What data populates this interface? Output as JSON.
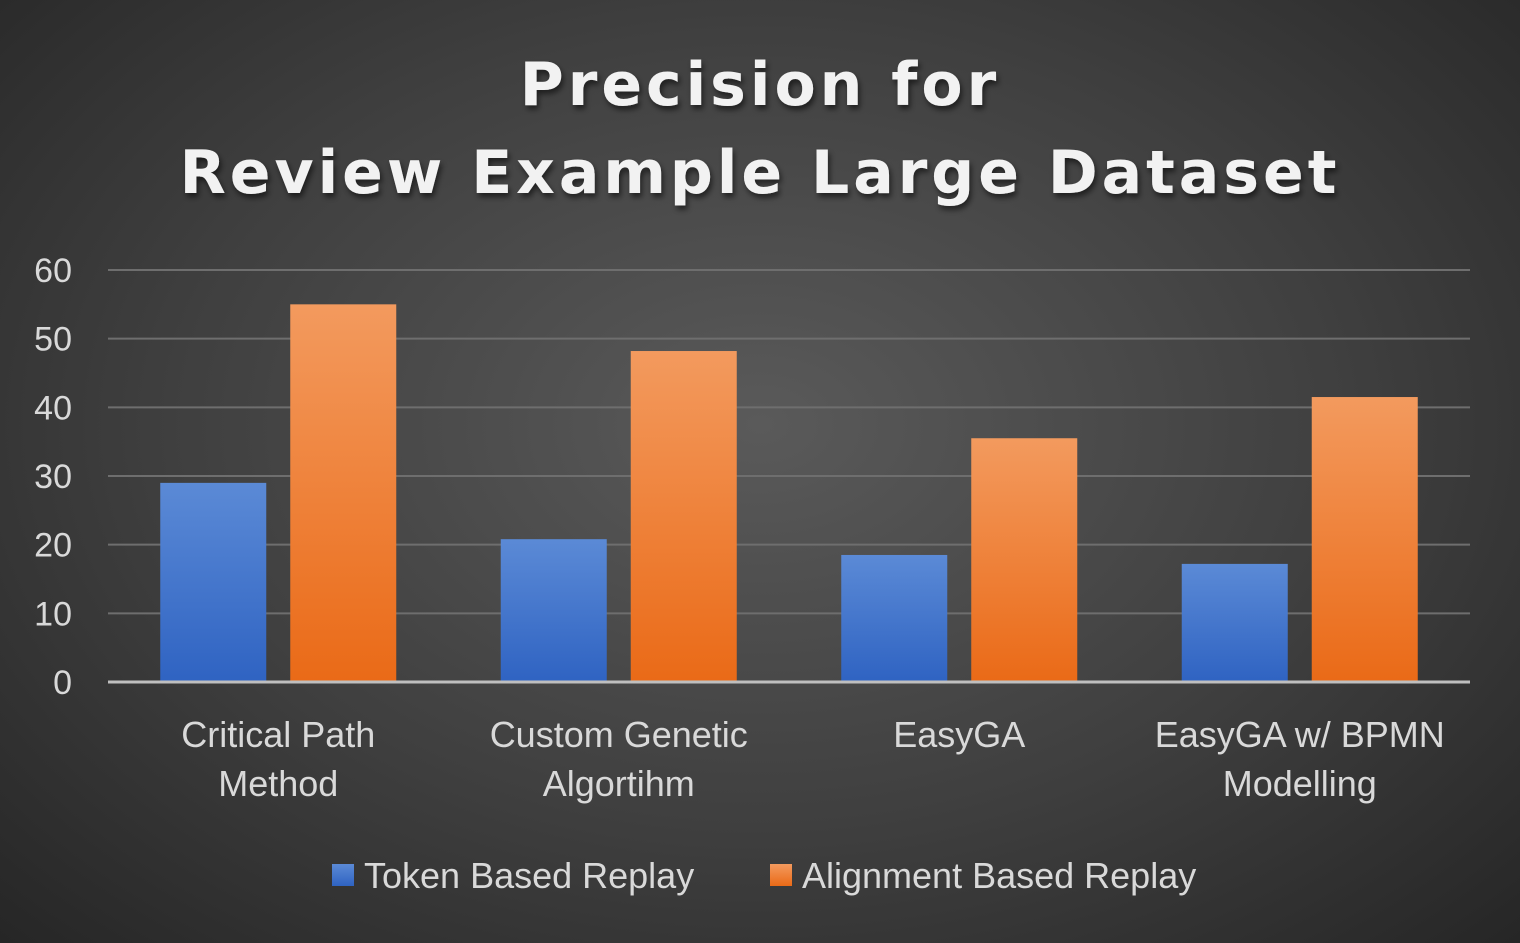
{
  "chart_data": {
    "type": "bar",
    "title_lines": [
      "Precision for",
      "Review Example Large Dataset"
    ],
    "categories": [
      [
        "Critical Path",
        "Method"
      ],
      [
        "Custom Genetic",
        "Algortihm"
      ],
      [
        "EasyGA"
      ],
      [
        "EasyGA w/ BPMN",
        "Modelling"
      ]
    ],
    "series": [
      {
        "name": "Token Based Replay",
        "values": [
          29,
          20.8,
          18.5,
          17.2
        ],
        "color_top": "#5b8ad6",
        "color_bottom": "#2f63c2"
      },
      {
        "name": "Alignment Based Replay",
        "values": [
          55,
          48.2,
          35.5,
          41.5
        ],
        "color_top": "#f39a5e",
        "color_bottom": "#ea6a17"
      }
    ],
    "yticks": [
      "0",
      "10",
      "20",
      "30",
      "40",
      "50",
      "60"
    ],
    "ylim": [
      0,
      60
    ],
    "grid": true,
    "legend": "bottom"
  }
}
